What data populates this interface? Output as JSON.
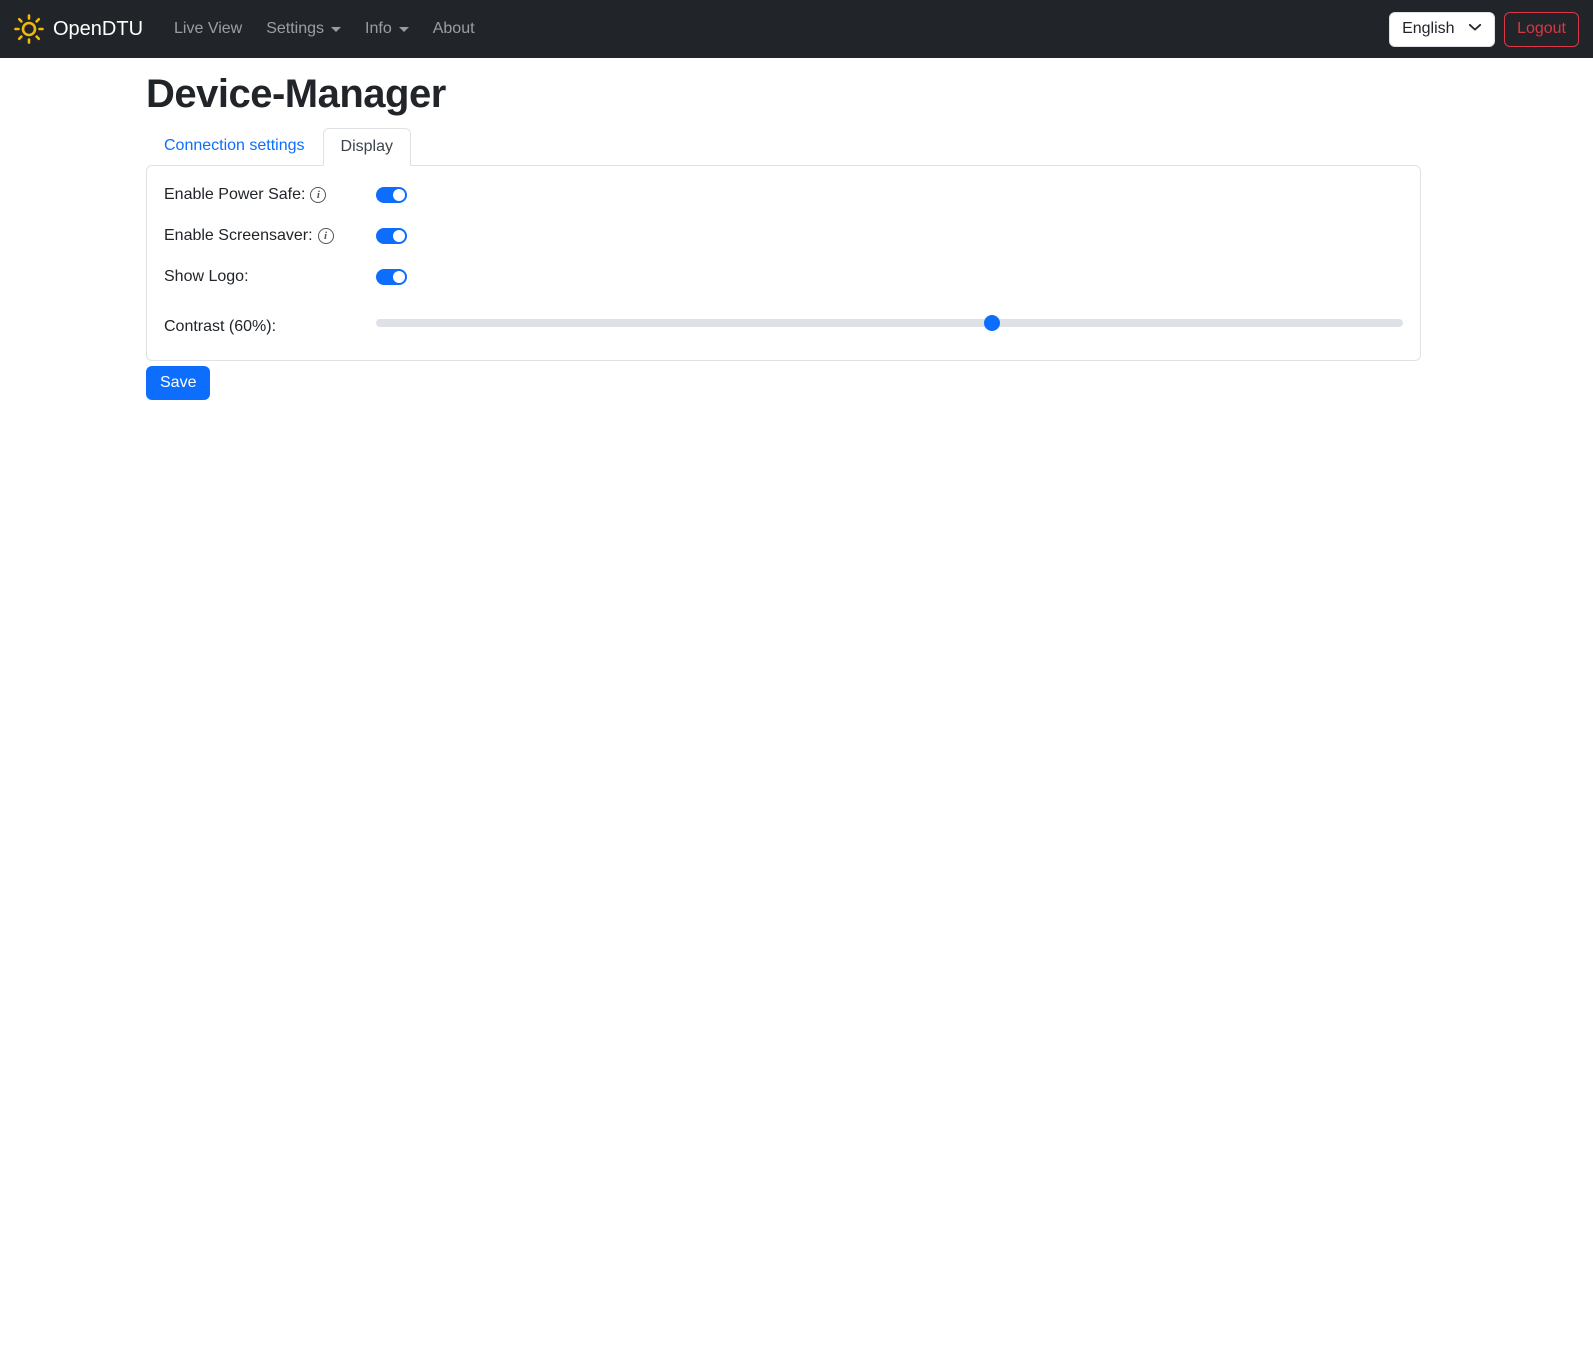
{
  "navbar": {
    "brand": "OpenDTU",
    "items": [
      {
        "label": "Live View",
        "caret": false
      },
      {
        "label": "Settings",
        "caret": true
      },
      {
        "label": "Info",
        "caret": true
      },
      {
        "label": "About",
        "caret": false
      }
    ],
    "language": {
      "selected": "English"
    },
    "logout_label": "Logout"
  },
  "page": {
    "title": "Device-Manager"
  },
  "tabs": {
    "connection_label": "Connection settings",
    "display_label": "Display",
    "active": "Display"
  },
  "display_form": {
    "switches": [
      {
        "label": "Enable Power Safe:",
        "info": true,
        "on": true
      },
      {
        "label": "Enable Screensaver:",
        "info": true,
        "on": true
      },
      {
        "label": "Show Logo:",
        "info": false,
        "on": true
      }
    ],
    "contrast": {
      "label": "Contrast (60%):",
      "percent": 60
    },
    "save_label": "Save"
  },
  "colors": {
    "accent": "#0d6efd",
    "navbar_bg": "#212529",
    "danger": "#dc3545",
    "slider_track": "#dee2e6",
    "brand_icon": "#f0b90b"
  }
}
